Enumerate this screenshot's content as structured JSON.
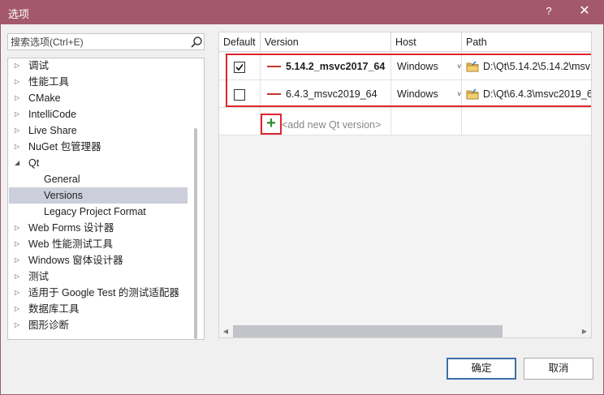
{
  "window": {
    "title": "选项",
    "help_label": "?",
    "close_label": "✕"
  },
  "search": {
    "placeholder": "搜索选项(Ctrl+E)",
    "icon": "search-icon"
  },
  "tree": {
    "items": [
      {
        "label": "调试",
        "expandable": true
      },
      {
        "label": "性能工具",
        "expandable": true
      },
      {
        "label": "CMake",
        "expandable": true
      },
      {
        "label": "IntelliCode",
        "expandable": true
      },
      {
        "label": "Live Share",
        "expandable": true
      },
      {
        "label": "NuGet 包管理器",
        "expandable": true
      },
      {
        "label": "Qt",
        "expandable": true,
        "expanded": true
      },
      {
        "label": "General",
        "child": true
      },
      {
        "label": "Versions",
        "child": true,
        "selected": true
      },
      {
        "label": "Legacy Project Format",
        "child": true
      },
      {
        "label": "Web Forms 设计器",
        "expandable": true
      },
      {
        "label": "Web 性能测试工具",
        "expandable": true
      },
      {
        "label": "Windows 窗体设计器",
        "expandable": true
      },
      {
        "label": "测试",
        "expandable": true
      },
      {
        "label": "适用于 Google Test 的测试适配器",
        "expandable": true
      },
      {
        "label": "数据库工具",
        "expandable": true
      },
      {
        "label": "图形诊断",
        "expandable": true
      }
    ]
  },
  "grid": {
    "columns": [
      "Default",
      "Version",
      "Host",
      "Path"
    ],
    "rows": [
      {
        "default": true,
        "version": "5.14.2_msvc2017_64",
        "bold": true,
        "host": "Windows",
        "path": "D:\\Qt\\5.14.2\\5.14.2\\msv"
      },
      {
        "default": false,
        "version": "6.4.3_msvc2019_64",
        "bold": false,
        "host": "Windows",
        "path": "D:\\Qt\\6.4.3\\msvc2019_6"
      }
    ],
    "add_label": "<add new Qt version>",
    "add_icon": "+",
    "dropdown_glyph": "˅"
  },
  "buttons": {
    "ok_label": "确定",
    "cancel_label": "取消"
  },
  "colors": {
    "titlebar": "#a3596b",
    "highlight": "#e0242b",
    "selection": "#cccedb",
    "version_dash": "#c0392b"
  }
}
